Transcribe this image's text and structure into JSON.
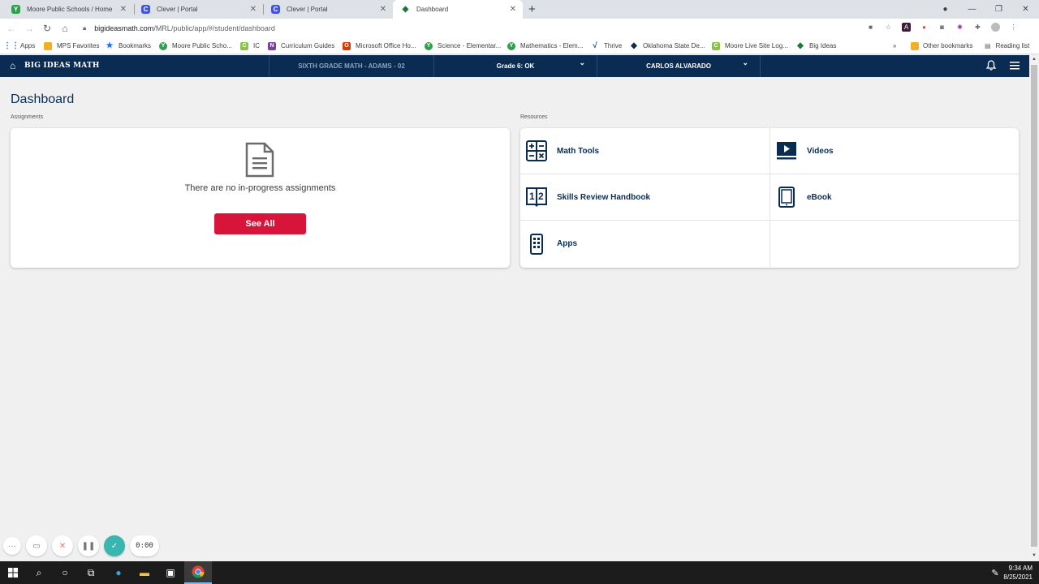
{
  "browser": {
    "tabs": [
      {
        "title": "Moore Public Schools / Home",
        "favicon_color": "#2e9f4d",
        "favicon_glyph": "Y"
      },
      {
        "title": "Clever | Portal",
        "favicon_color": "#4356cf",
        "favicon_glyph": "C"
      },
      {
        "title": "Clever | Portal",
        "favicon_color": "#4356cf",
        "favicon_glyph": "C"
      },
      {
        "title": "Dashboard",
        "favicon_color": "#1a7a3a",
        "favicon_glyph": "◆",
        "active": true
      }
    ],
    "new_tab": "+",
    "url_host": "bigideasmath.com",
    "url_path": "/MRL/public/app/#/student/dashboard",
    "bookmarks": [
      {
        "label": "Apps",
        "icon_color": "#1a73e8",
        "glyph": "⋮"
      },
      {
        "label": "MPS Favorites",
        "icon_color": "#f2b01e",
        "glyph": ""
      },
      {
        "label": "Bookmarks",
        "icon_color": "#1a73e8",
        "glyph": "★"
      },
      {
        "label": "Moore Public Scho...",
        "icon_color": "#2e9f4d",
        "glyph": "Y"
      },
      {
        "label": "IC",
        "icon_color": "#8bc34a",
        "glyph": "C"
      },
      {
        "label": "Curriculum Guides",
        "icon_color": "#7b3fa0",
        "glyph": "N"
      },
      {
        "label": "Microsoft Office Ho...",
        "icon_color": "#d83b01",
        "glyph": "O"
      },
      {
        "label": "Science - Elementar...",
        "icon_color": "#2e9f4d",
        "glyph": "Y"
      },
      {
        "label": "Mathematics - Elem...",
        "icon_color": "#2e9f4d",
        "glyph": "Y"
      },
      {
        "label": "Thrive",
        "icon_color": "#ffffff",
        "glyph": "√"
      },
      {
        "label": "Oklahoma State De...",
        "icon_color": "#0a2c52",
        "glyph": "◆"
      },
      {
        "label": "Moore Live Site Log...",
        "icon_color": "#8bc34a",
        "glyph": "C"
      },
      {
        "label": "Big Ideas",
        "icon_color": "#1a7a3a",
        "glyph": "◆"
      }
    ],
    "bookmarks_more": "»",
    "other_bookmarks": "Other bookmarks",
    "reading_list": "Reading list"
  },
  "app": {
    "brand": "BIG IDEAS MATH",
    "course": "SIXTH GRADE MATH - ADAMS - 02",
    "grade": "Grade 6: OK",
    "user": "CARLOS ALVARADO",
    "accent": "#0a2c52",
    "button_color": "#d7153a"
  },
  "dashboard": {
    "title": "Dashboard",
    "assignments_label": "Assignments",
    "empty_message": "There are no in-progress assignments",
    "see_all": "See All",
    "resources_label": "Resources",
    "resources": [
      {
        "label": "Math Tools",
        "icon": "math-tools-icon"
      },
      {
        "label": "Videos",
        "icon": "videos-icon"
      },
      {
        "label": "Skills Review Handbook",
        "icon": "handbook-icon"
      },
      {
        "label": "eBook",
        "icon": "ebook-icon"
      },
      {
        "label": "Apps",
        "icon": "apps-icon"
      }
    ]
  },
  "recorder": {
    "timer": "0:00"
  },
  "taskbar": {
    "time": "9:34 AM",
    "date": "8/25/2021"
  }
}
